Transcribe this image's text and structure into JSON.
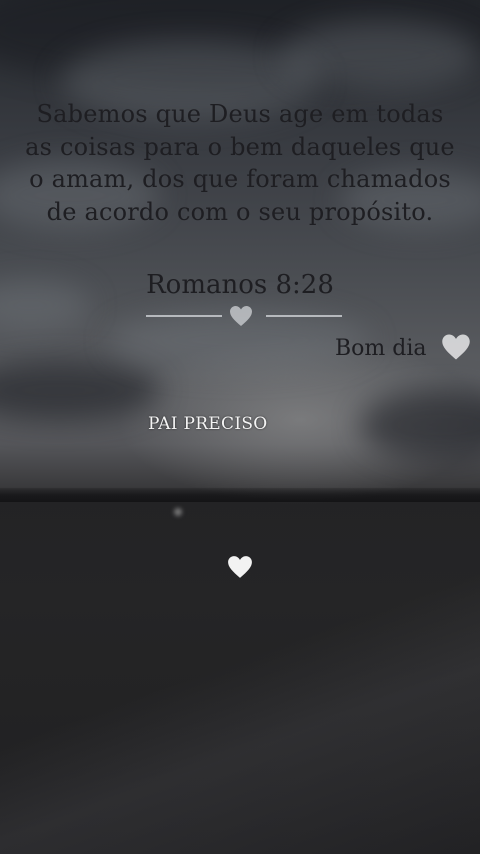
{
  "post": {
    "verse": "Sabemos que Deus age em todas as coisas para o bem daqueles que o amam, dos que foram chamados de acordo com o seu propósito.",
    "reference": "Romanos 8:28",
    "greeting": "Bom dia",
    "tag": "PAI PRECISO"
  },
  "icons": {
    "divider": "heart-icon",
    "greeting": "heart-icon",
    "center": "heart-icon"
  },
  "colors": {
    "text_dark": "#1e1e22",
    "heart": "#f2f2f2",
    "tag_text": "#f4f4f4"
  }
}
